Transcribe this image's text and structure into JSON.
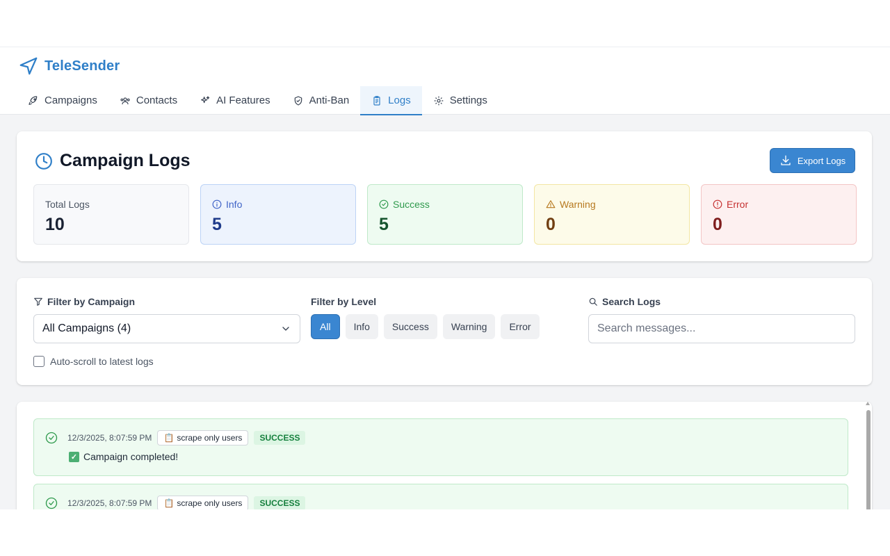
{
  "app": {
    "name": "TeleSender",
    "accent": "#2f7fc8"
  },
  "tabs": [
    {
      "label": "Campaigns",
      "icon": "rocket-icon"
    },
    {
      "label": "Contacts",
      "icon": "users-icon"
    },
    {
      "label": "AI Features",
      "icon": "sparkles-icon"
    },
    {
      "label": "Anti-Ban",
      "icon": "shield-icon"
    },
    {
      "label": "Logs",
      "icon": "clipboard-icon",
      "active": true
    },
    {
      "label": "Settings",
      "icon": "gear-icon"
    }
  ],
  "page": {
    "title": "Campaign Logs",
    "export_label": "Export Logs"
  },
  "stats": {
    "total": {
      "label": "Total Logs",
      "value": "10"
    },
    "info": {
      "label": "Info",
      "value": "5"
    },
    "success": {
      "label": "Success",
      "value": "5"
    },
    "warning": {
      "label": "Warning",
      "value": "0"
    },
    "error": {
      "label": "Error",
      "value": "0"
    }
  },
  "filters": {
    "campaign_label": "Filter by Campaign",
    "campaign_selected": "All Campaigns (4)",
    "level_label": "Filter by Level",
    "levels": [
      "All",
      "Info",
      "Success",
      "Warning",
      "Error"
    ],
    "active_level": "All",
    "search_label": "Search Logs",
    "search_placeholder": "Search messages...",
    "auto_scroll_label": "Auto-scroll to latest logs",
    "auto_scroll_checked": false
  },
  "logs": [
    {
      "timestamp": "12/3/2025, 8:07:59 PM",
      "campaign": "scrape only users",
      "level": "SUCCESS",
      "message": "Campaign completed!"
    },
    {
      "timestamp": "12/3/2025, 8:07:59 PM",
      "campaign": "scrape only users",
      "level": "SUCCESS",
      "message": ""
    }
  ]
}
